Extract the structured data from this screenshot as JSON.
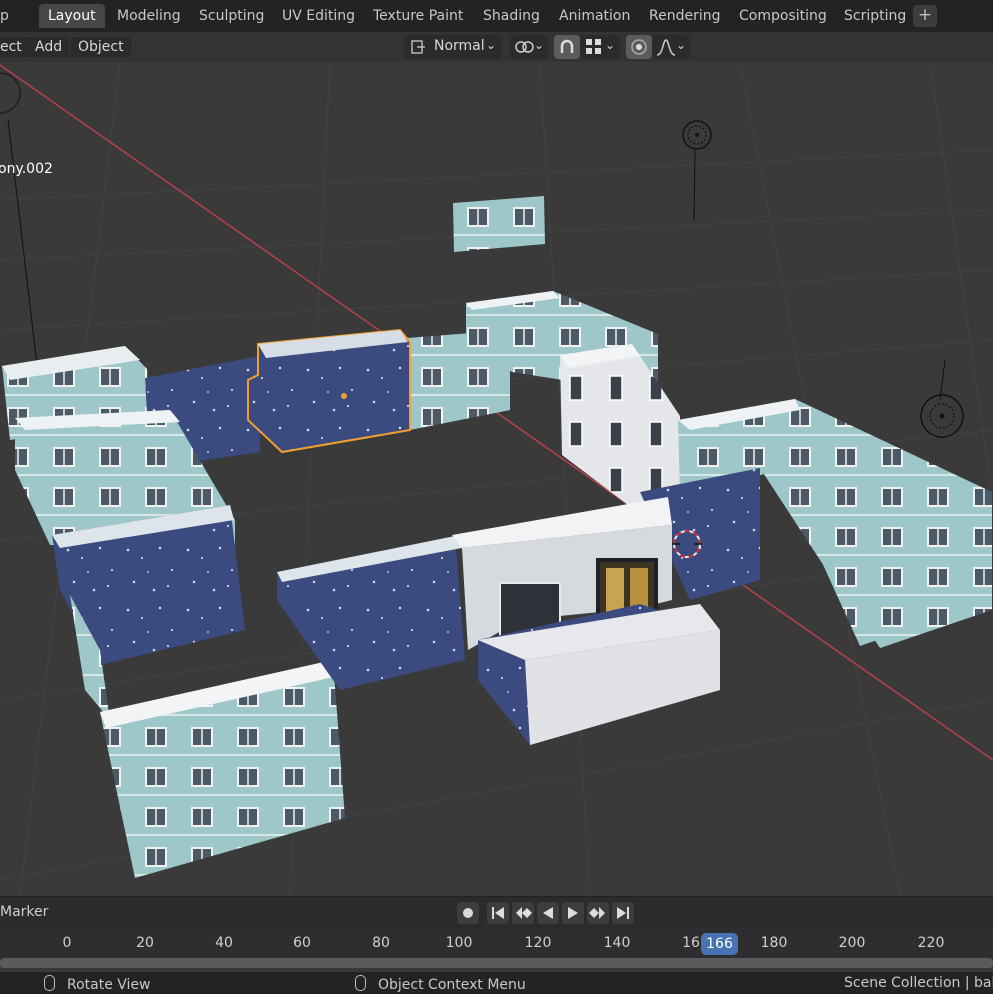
{
  "app": {
    "file_menu_fragment": "p"
  },
  "workspaces": [
    {
      "label": "Layout",
      "active": true
    },
    {
      "label": "Modeling"
    },
    {
      "label": "Sculpting"
    },
    {
      "label": "UV Editing"
    },
    {
      "label": "Texture Paint"
    },
    {
      "label": "Shading"
    },
    {
      "label": "Animation"
    },
    {
      "label": "Rendering"
    },
    {
      "label": "Compositing"
    },
    {
      "label": "Scripting"
    }
  ],
  "add_workspace": "+",
  "viewport_header": {
    "menus": [
      "ect",
      "Add",
      "Object"
    ],
    "orientation": "Normal"
  },
  "viewport": {
    "object_label": "ony.002"
  },
  "timeline": {
    "marker_label": "Marker",
    "ticks": [
      "0",
      "20",
      "40",
      "60",
      "80",
      "100",
      "120",
      "140",
      "16",
      "180",
      "200",
      "220"
    ],
    "current_frame": "166"
  },
  "statusbar": {
    "left_action": "Rotate View",
    "middle_action": "Object Context Menu",
    "right_text": "Scene Collection | balco"
  },
  "colors": {
    "accent": "#4772b3",
    "selection_outline": "#f0a030",
    "x_axis": "#b8404a"
  }
}
